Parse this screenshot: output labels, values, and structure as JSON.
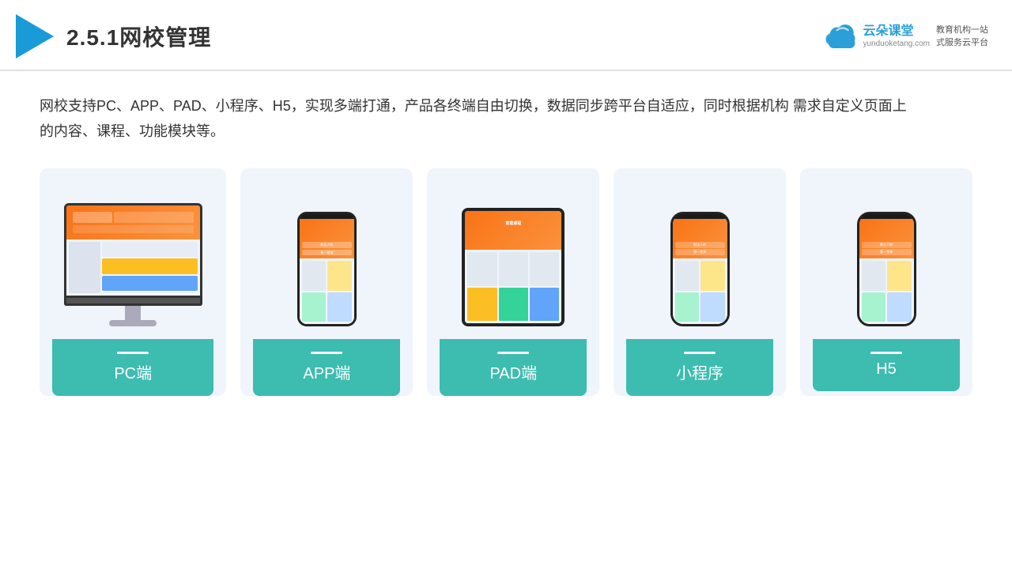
{
  "header": {
    "title": "2.5.1网校管理",
    "brand": {
      "name": "云朵课堂",
      "domain": "yunduoketang.com",
      "slogan": "教育机构一站\n式服务云平台"
    }
  },
  "description": "网校支持PC、APP、PAD、小程序、H5，实现多端打通，产品各终端自由切换，数据同步跨平台自适应，同时根据机构\n需求自定义页面上的内容、课程、功能模块等。",
  "cards": [
    {
      "id": "pc",
      "label": "PC端"
    },
    {
      "id": "app",
      "label": "APP端"
    },
    {
      "id": "pad",
      "label": "PAD端"
    },
    {
      "id": "miniprogram",
      "label": "小程序"
    },
    {
      "id": "h5",
      "label": "H5"
    }
  ],
  "accent_color": "#3dbcb0"
}
